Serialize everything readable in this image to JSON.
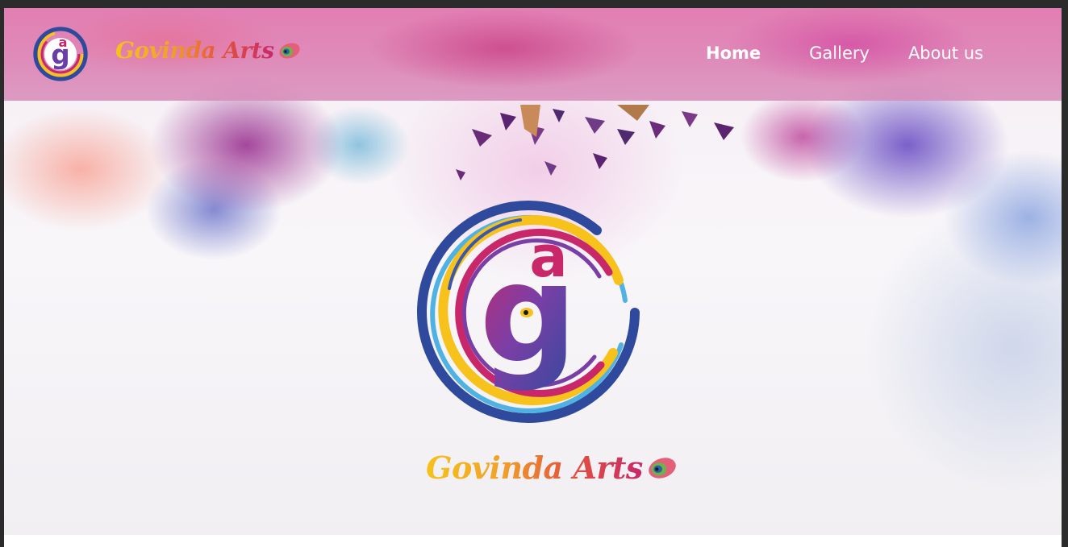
{
  "brand": {
    "name": "Govinda Arts",
    "logo_icon": "ga-circle-logo-icon",
    "feather_icon": "peacock-feather-icon"
  },
  "nav": {
    "items": [
      {
        "label": "Home",
        "active": true
      },
      {
        "label": "Gallery",
        "active": false
      },
      {
        "label": "About us",
        "active": false
      }
    ]
  },
  "hero": {
    "title": "Govinda Arts"
  },
  "colors": {
    "navbar": "#e07fb4",
    "nav_text": "#ffffff",
    "logo_blue": "#2f4a9c",
    "logo_yellow": "#f7c21b",
    "logo_pink": "#c8286a",
    "logo_purple": "#7a3fa6",
    "wordmark_start": "#f7c21b",
    "wordmark_end": "#c8286a"
  }
}
